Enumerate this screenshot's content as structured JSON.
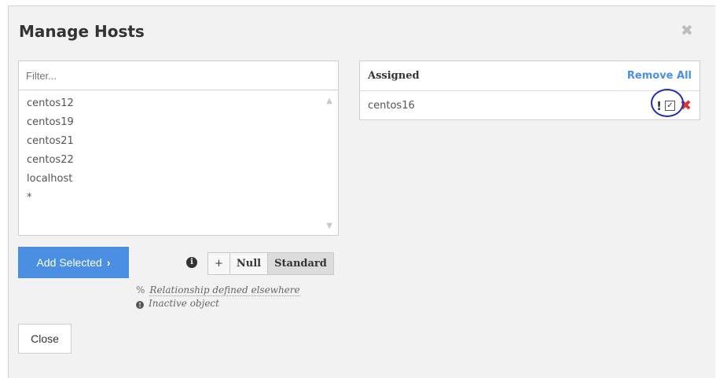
{
  "dialog": {
    "title": "Manage Hosts",
    "close_icon": "close-icon"
  },
  "available": {
    "filter_placeholder": "Filter...",
    "items": [
      "centos12",
      "centos19",
      "centos21",
      "centos22",
      "localhost",
      "*"
    ]
  },
  "actions": {
    "add_selected_label": "Add Selected",
    "add_selected_icon": "›",
    "close_label": "Close"
  },
  "relationship": {
    "options": [
      "+",
      "Null",
      "Standard"
    ],
    "selected": "Standard"
  },
  "legend": {
    "relationship_elsewhere": "Relationship defined elsewhere",
    "inactive_object": "Inactive object"
  },
  "assigned": {
    "header": "Assigned",
    "remove_all_label": "Remove All",
    "rows": [
      {
        "host": "centos16",
        "flag": "!",
        "checked": "☑",
        "delete": "✖"
      }
    ]
  },
  "colors": {
    "accent": "#4a8fe2",
    "delete": "#d63535",
    "highlight": "#1f2fb2"
  }
}
